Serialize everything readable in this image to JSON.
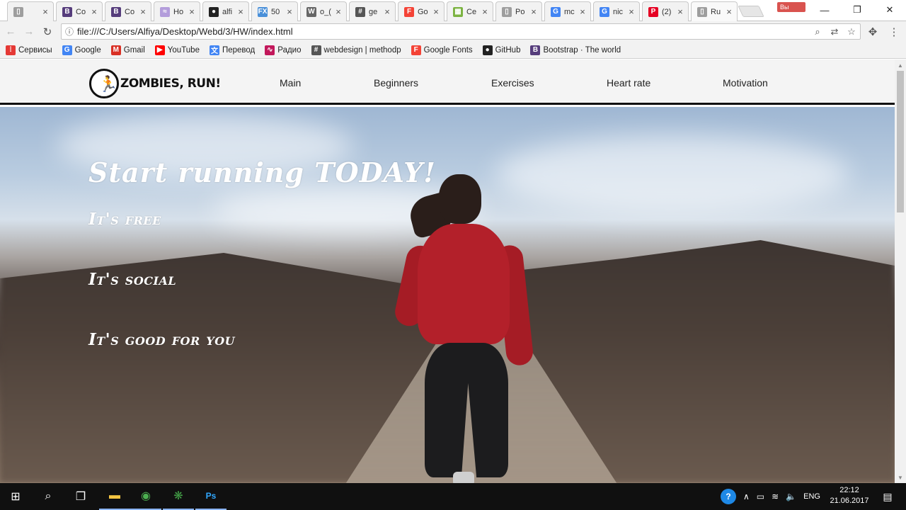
{
  "browser": {
    "tabs": [
      {
        "title": "",
        "icon": "page-icon",
        "color": "#9e9e9e"
      },
      {
        "title": "Co",
        "icon": "bootstrap-icon",
        "color": "#563d7c"
      },
      {
        "title": "Co",
        "icon": "bootstrap-icon",
        "color": "#563d7c"
      },
      {
        "title": "Ho",
        "icon": "feather-icon",
        "color": "#b39ddb"
      },
      {
        "title": "alfi",
        "icon": "github-icon",
        "color": "#222222"
      },
      {
        "title": "50",
        "icon": "fx-icon",
        "color": "#4a90d9"
      },
      {
        "title": "o_(",
        "icon": "wikipedia-icon",
        "color": "#666666"
      },
      {
        "title": "ge",
        "icon": "hash-icon",
        "color": "#555555"
      },
      {
        "title": "Go",
        "icon": "google-fonts-icon",
        "color": "#f44336"
      },
      {
        "title": "Ce",
        "icon": "palette-icon",
        "color": "#7cb342"
      },
      {
        "title": "Po",
        "icon": "page-icon",
        "color": "#9e9e9e"
      },
      {
        "title": "mc",
        "icon": "google-icon",
        "color": "#4285f4"
      },
      {
        "title": "nic",
        "icon": "google-icon",
        "color": "#4285f4"
      },
      {
        "title": "(2)",
        "icon": "pinterest-icon",
        "color": "#e60023"
      },
      {
        "title": "Ru",
        "icon": "page-icon",
        "color": "#9e9e9e",
        "active": true
      }
    ],
    "profile_label": "Вы",
    "address": "file:///C:/Users/Alfiya/Desktop/Webd/3/HW/index.html",
    "bookmarks": [
      {
        "label": "Сервисы",
        "icon": "apps-grid-icon",
        "color": "#e53935"
      },
      {
        "label": "Google",
        "icon": "google-icon",
        "color": "#4285f4"
      },
      {
        "label": "Gmail",
        "icon": "gmail-icon",
        "color": "#d93025"
      },
      {
        "label": "YouTube",
        "icon": "youtube-icon",
        "color": "#ff0000"
      },
      {
        "label": "Перевод",
        "icon": "translate-icon",
        "color": "#4285f4"
      },
      {
        "label": "Радио",
        "icon": "radio-icon",
        "color": "#c2185b"
      },
      {
        "label": "webdesign | methodp",
        "icon": "hash-icon",
        "color": "#555555"
      },
      {
        "label": "Google Fonts",
        "icon": "google-fonts-icon",
        "color": "#f44336"
      },
      {
        "label": "GitHub",
        "icon": "github-icon",
        "color": "#222222"
      },
      {
        "label": "Bootstrap · The world",
        "icon": "bootstrap-icon",
        "color": "#563d7c"
      }
    ]
  },
  "site": {
    "logo_text": "ZOMBIES, RUN!",
    "nav": [
      "Main",
      "Beginners",
      "Exercises",
      "Heart rate",
      "Motivation"
    ],
    "hero_title": "Start running TODAY!",
    "hero_lines": [
      "It's free",
      "It's social",
      "It's good for you"
    ]
  },
  "taskbar": {
    "language": "ENG",
    "time": "22:12",
    "date": "21.06.2017"
  },
  "colors": {
    "header_border": "#111111",
    "jacket": "#b3202a"
  }
}
